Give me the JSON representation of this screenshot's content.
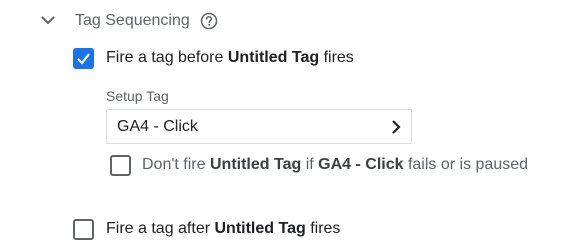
{
  "section": {
    "title": "Tag Sequencing",
    "expanded": true
  },
  "fire_before": {
    "checked": true,
    "label_prefix": "Fire a tag before",
    "tag_name": "Untitled Tag",
    "label_suffix": "fires"
  },
  "setup_tag": {
    "label": "Setup Tag",
    "value": "GA4 - Click"
  },
  "dont_fire": {
    "checked": false,
    "prefix": "Don't fire",
    "tag_name": "Untitled Tag",
    "middle": "if",
    "setup_name": "GA4 - Click",
    "suffix": "fails or is paused"
  },
  "fire_after": {
    "checked": false,
    "label_prefix": "Fire a tag after",
    "tag_name": "Untitled Tag",
    "label_suffix": "fires"
  },
  "colors": {
    "accent": "#1a73e8",
    "text_primary": "#202124",
    "text_secondary": "#5f6368",
    "border": "#dadce0"
  },
  "icons": {
    "section_toggle": "chevron-down-icon",
    "help": "help-circle-icon",
    "check": "check-icon",
    "select_arrow": "chevron-right-icon"
  }
}
